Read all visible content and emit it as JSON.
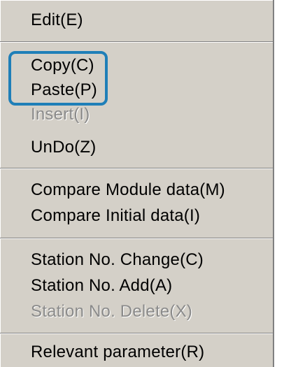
{
  "menu": {
    "items": [
      {
        "label": "Edit(E)",
        "enabled": true
      },
      {
        "label": "Copy(C)",
        "enabled": true
      },
      {
        "label": "Paste(P)",
        "enabled": true
      },
      {
        "label": "Insert(I)",
        "enabled": false
      },
      {
        "label": "UnDo(Z)",
        "enabled": true
      },
      {
        "label": "Compare Module data(M)",
        "enabled": true
      },
      {
        "label": "Compare Initial data(I)",
        "enabled": true
      },
      {
        "label": "Station No. Change(C)",
        "enabled": true
      },
      {
        "label": "Station No. Add(A)",
        "enabled": true
      },
      {
        "label": "Station No. Delete(X)",
        "enabled": false
      },
      {
        "label": "Relevant parameter(R)",
        "enabled": true
      }
    ]
  },
  "colors": {
    "menu_background": "#d4d0c8",
    "disabled_text": "#8a8a8a",
    "highlight_outline": "#1f7fb8"
  }
}
